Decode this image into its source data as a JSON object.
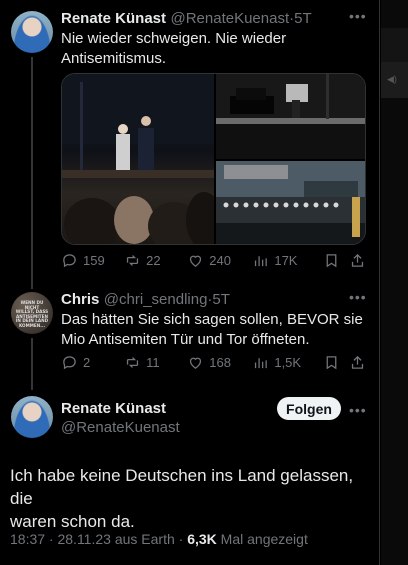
{
  "tweet1": {
    "author_name": "Renate Künast",
    "author_handle": "@RenateKuenast",
    "time": "5T",
    "text_line1": "Nie wieder schweigen. Nie wieder",
    "text_line2": "Antisemitismus.",
    "stats": {
      "replies": "159",
      "retweets": "22",
      "likes": "240",
      "views": "17K"
    }
  },
  "tweet2": {
    "author_name": "Chris",
    "author_handle": "@chri_sendling",
    "time": "5T",
    "avatar_text": "WENN DU NICHT WILLST, DASS ANTISEMITEN IN DEIN LAND KOMMEN...",
    "text_line1": "Das hätten Sie sich sagen sollen, BEVOR sie",
    "text_line2": "Mio Antisemiten Tür und Tor öffneten.",
    "stats": {
      "replies": "2",
      "retweets": "11",
      "likes": "168",
      "views": "1,5K"
    }
  },
  "tweet3": {
    "author_name": "Renate Künast",
    "author_handle": "@RenateKuenast",
    "follow_label": "Folgen",
    "text_line1": "Ich habe keine Deutschen ins Land gelassen, die",
    "text_line2": "waren schon da.",
    "timestamp": "18:37 · 28.11.23 aus Earth ·",
    "views_count": "6,3K",
    "views_label": "Mal angezeigt"
  },
  "icons": {
    "more": "more-horizontal-icon",
    "reply": "reply-icon",
    "retweet": "retweet-icon",
    "like": "heart-icon",
    "views": "views-icon",
    "bookmark": "bookmark-icon",
    "share": "share-icon"
  },
  "colors": {
    "bg": "#000000",
    "text": "#e7e9ea",
    "muted": "#71767b",
    "follow_bg": "#eff3f4"
  }
}
